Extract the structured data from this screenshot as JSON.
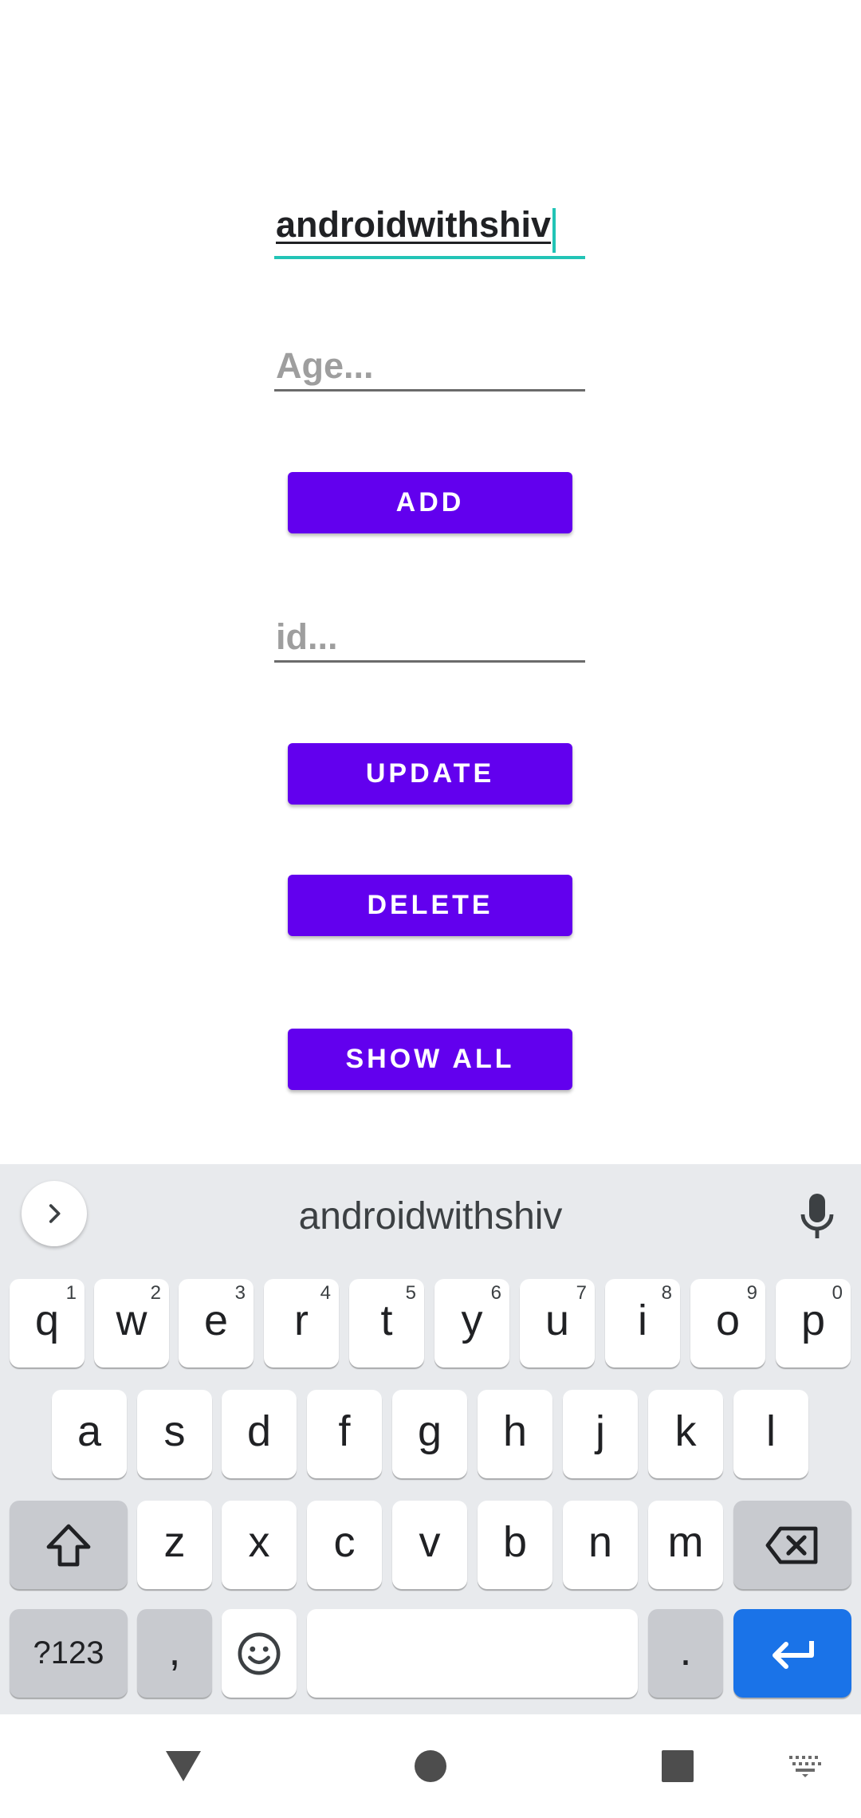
{
  "form": {
    "name_value": "androidwithshiv",
    "age_placeholder": "Age...",
    "id_placeholder": "id...",
    "add_label": "ADD",
    "update_label": "UPDATE",
    "delete_label": "DELETE",
    "show_all_label": "SHOW ALL"
  },
  "keyboard": {
    "suggestion": "androidwithshiv",
    "row1": [
      {
        "key": "q",
        "hint": "1"
      },
      {
        "key": "w",
        "hint": "2"
      },
      {
        "key": "e",
        "hint": "3"
      },
      {
        "key": "r",
        "hint": "4"
      },
      {
        "key": "t",
        "hint": "5"
      },
      {
        "key": "y",
        "hint": "6"
      },
      {
        "key": "u",
        "hint": "7"
      },
      {
        "key": "i",
        "hint": "8"
      },
      {
        "key": "o",
        "hint": "9"
      },
      {
        "key": "p",
        "hint": "0"
      }
    ],
    "row2": [
      "a",
      "s",
      "d",
      "f",
      "g",
      "h",
      "j",
      "k",
      "l"
    ],
    "row3": [
      "z",
      "x",
      "c",
      "v",
      "b",
      "n",
      "m"
    ],
    "symbols_label": "?123",
    "comma_label": ",",
    "period_label": "."
  },
  "colors": {
    "accent": "#6200ee",
    "focus_underline": "#22c4b6",
    "enter_key": "#1a73e8",
    "keyboard_bg": "#e8eaed"
  },
  "icons": {
    "suggest_expand": "chevron-right-icon",
    "voice": "mic-icon",
    "shift": "shift-arrow-icon",
    "backspace": "backspace-icon",
    "emoji": "emoji-icon",
    "enter": "enter-arrow-icon",
    "nav_back": "triangle-back-icon",
    "nav_home": "circle-home-icon",
    "nav_recents": "square-recents-icon",
    "keyboard_switch": "keyboard-icon"
  }
}
